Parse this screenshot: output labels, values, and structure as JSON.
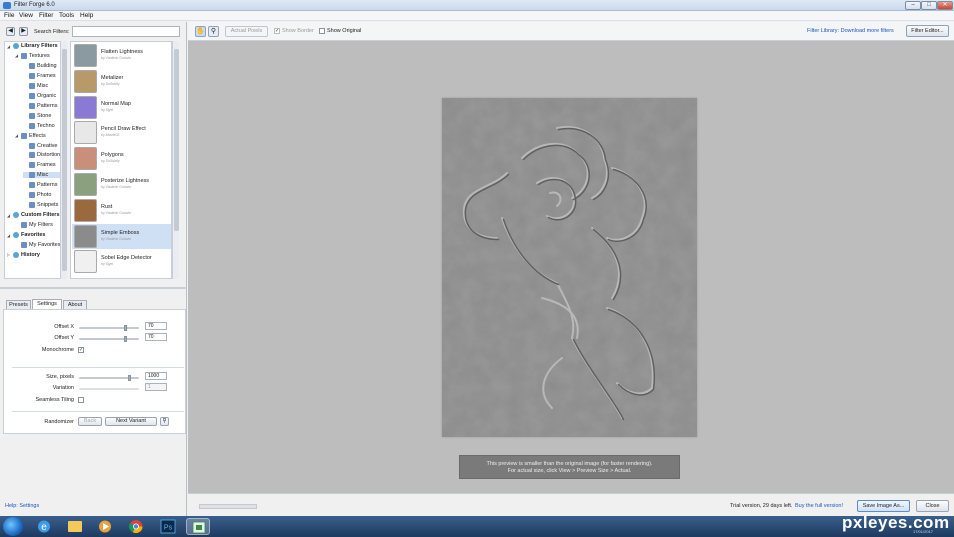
{
  "window": {
    "title": "Filter Forge 6.0",
    "min": "–",
    "max": "□",
    "close": "✕"
  },
  "menu": [
    "File",
    "View",
    "Filter",
    "Tools",
    "Help"
  ],
  "search": {
    "label": "Search Filters:",
    "value": "",
    "back": "◀",
    "forward": "▶"
  },
  "tree": [
    {
      "label": "Library Filters",
      "level": 0,
      "type": "cat",
      "expanded": true
    },
    {
      "label": "Textures",
      "level": 1,
      "type": "folder",
      "expanded": true
    },
    {
      "label": "Building",
      "level": 2,
      "type": "leaf"
    },
    {
      "label": "Frames",
      "level": 2,
      "type": "leaf"
    },
    {
      "label": "Misc",
      "level": 2,
      "type": "leaf"
    },
    {
      "label": "Organic",
      "level": 2,
      "type": "leaf"
    },
    {
      "label": "Patterns",
      "level": 2,
      "type": "leaf"
    },
    {
      "label": "Stone",
      "level": 2,
      "type": "leaf"
    },
    {
      "label": "Techno",
      "level": 2,
      "type": "leaf"
    },
    {
      "label": "Effects",
      "level": 1,
      "type": "folder",
      "expanded": true
    },
    {
      "label": "Creative",
      "level": 2,
      "type": "leaf"
    },
    {
      "label": "Distortions",
      "level": 2,
      "type": "leaf"
    },
    {
      "label": "Frames",
      "level": 2,
      "type": "leaf"
    },
    {
      "label": "Misc",
      "level": 2,
      "type": "leaf",
      "selected": true
    },
    {
      "label": "Patterns",
      "level": 2,
      "type": "leaf"
    },
    {
      "label": "Photo",
      "level": 2,
      "type": "leaf"
    },
    {
      "label": "Snippets",
      "level": 2,
      "type": "leaf"
    },
    {
      "label": "Custom Filters",
      "level": 0,
      "type": "cat",
      "expanded": true
    },
    {
      "label": "My Filters",
      "level": 1,
      "type": "leaf"
    },
    {
      "label": "Favorites",
      "level": 0,
      "type": "cat",
      "expanded": true
    },
    {
      "label": "My Favorites",
      "level": 1,
      "type": "leaf"
    },
    {
      "label": "History",
      "level": 0,
      "type": "cat",
      "expanded": false
    }
  ],
  "filters": [
    {
      "name": "Flatten Lightness",
      "author": "by Vladimir Golovin",
      "color": "#8a9aa0"
    },
    {
      "name": "Metalizer",
      "author": "by SoSubtly",
      "color": "#b89a6a"
    },
    {
      "name": "Normal Map",
      "author": "by Sjyel",
      "color": "#8a7ad6"
    },
    {
      "name": "Pencil Draw Effect",
      "author": "by Mizzle02",
      "color": "#e8e8e8"
    },
    {
      "name": "Polygons",
      "author": "by SoSubtly",
      "color": "#c98f7a"
    },
    {
      "name": "Posterize Lightness",
      "author": "by Vladimir Golovin",
      "color": "#8aa07e"
    },
    {
      "name": "Rust",
      "author": "by Vladimir Golovin",
      "color": "#9a6a3e"
    },
    {
      "name": "Simple Emboss",
      "author": "by Vladimir Golovin",
      "color": "#8b8b8b",
      "selected": true
    },
    {
      "name": "Sobel Edge Detector",
      "author": "by Sjyel",
      "color": "#f0f0f0"
    }
  ],
  "tabs": [
    "Presets",
    "Settings",
    "About"
  ],
  "settings": {
    "offset_x": {
      "label": "Offset X",
      "value": "70",
      "level": 0.5
    },
    "offset_y": {
      "label": "Offset Y",
      "value": "70",
      "level": 0.5
    },
    "monochrome": {
      "label": "Monochrome",
      "checked": true
    },
    "size": {
      "label": "Size, pixels",
      "value": "1000",
      "level": 0.55
    },
    "variation": {
      "label": "Variation",
      "value": "1"
    },
    "seamless": {
      "label": "Seamless Tiling",
      "checked": false
    },
    "randomizer": {
      "label": "Randomizer",
      "back": "Back",
      "next": "Next Variant"
    }
  },
  "help_text": "Help: Settings",
  "toolbar": {
    "actual_pixels": "Actual Pixels",
    "show_border": "Show Border",
    "show_original": "Show Original",
    "library_link": "Filter Library: Download more filters",
    "filter_editor": "Filter Editor..."
  },
  "notice": [
    "This preview is smaller than the original image (for faster rendering).",
    "For actual size, click View > Preview Size > Actual."
  ],
  "status": {
    "trial": "Trial version, 29 days left.",
    "buy": "Buy the full version!",
    "save": "Save Image As...",
    "close": "Close"
  },
  "watermark": "pxleyes.com",
  "clock_date": "17/01/2017"
}
